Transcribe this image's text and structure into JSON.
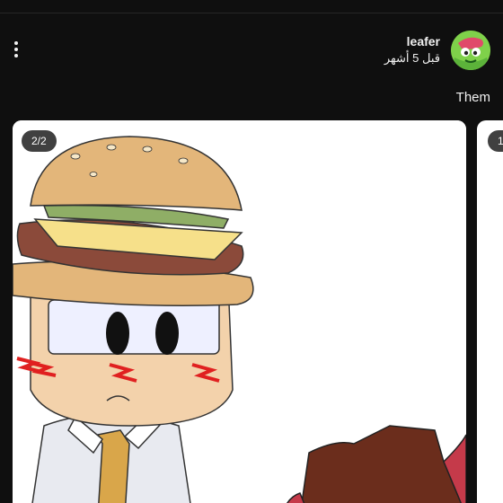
{
  "post": {
    "channel_name": "leafer",
    "time_ago": "قبل 5 أشهر",
    "text": "Them",
    "image_counter": "2/2",
    "next_image_counter": "1"
  },
  "icons": {
    "menu": "more-vert-icon",
    "avatar": "channel-avatar"
  },
  "colors": {
    "background": "#0f0f0f",
    "text": "#f1f1f1",
    "card": "#ffffff"
  }
}
